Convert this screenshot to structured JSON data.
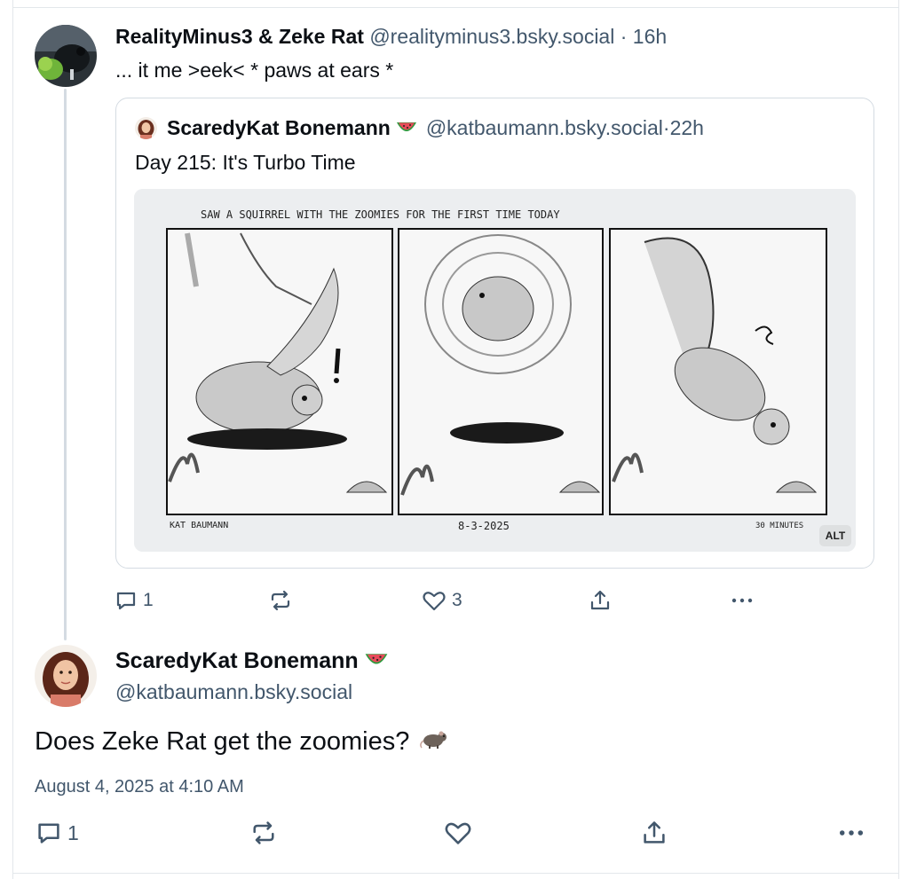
{
  "parent_post": {
    "display_name": "RealityMinus3 & Zeke Rat",
    "handle": "@realityminus3.bsky.social",
    "separator": " · ",
    "time": "16h",
    "text": "... it me >eek< * paws at ears *",
    "quote": {
      "display_name": "ScaredyKat Bonemann",
      "handle": "@katbaumann.bsky.social",
      "separator": " · ",
      "time": "22h",
      "text": "Day 215: It's Turbo Time",
      "image": {
        "caption": "SAW A SQUIRREL WITH THE ZOOMIES FOR THE FIRST TIME TODAY",
        "signature": "KAT BAUMANN",
        "date": "8-3-2025",
        "duration": "30 MINUTES",
        "alt_badge": "ALT"
      }
    },
    "actions": {
      "reply_count": "1",
      "like_count": "3"
    }
  },
  "main_post": {
    "display_name": "ScaredyKat Bonemann",
    "handle": "@katbaumann.bsky.social",
    "text": "Does Zeke Rat get the zoomies?",
    "timestamp": "August 4, 2025 at 4:10 AM",
    "actions": {
      "reply_count": "1"
    }
  },
  "icons": [
    "reply-icon",
    "repost-icon",
    "like-icon",
    "share-icon",
    "more-icon",
    "watermelon-icon",
    "rat-icon"
  ],
  "colors": {
    "muted": "#42576c",
    "text": "#0b0f14",
    "border": "#d4dbe2"
  }
}
